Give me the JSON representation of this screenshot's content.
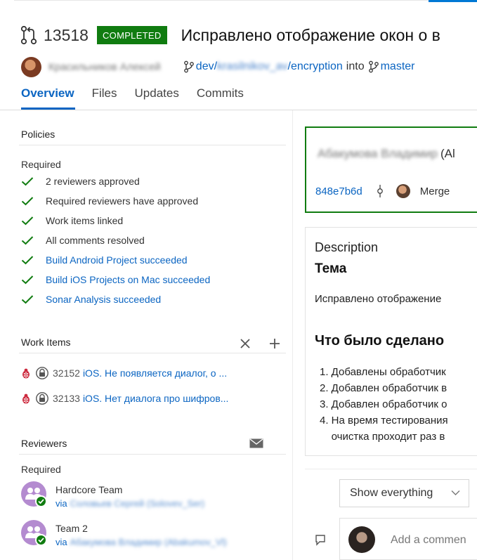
{
  "header": {
    "pr_number": "13518",
    "status_badge": "COMPLETED",
    "title": "Исправлено отображение окон о в",
    "author": "Красильников Алексей",
    "source_branch_prefix": "dev/",
    "source_branch_user": "krasilnikov_av",
    "source_branch_suffix": "/encryption",
    "into": "into",
    "target_branch": "master",
    "tabs": [
      "Overview",
      "Files",
      "Updates",
      "Commits"
    ]
  },
  "policies": {
    "title": "Policies",
    "required_label": "Required",
    "items": [
      {
        "label": "2 reviewers approved",
        "link": false
      },
      {
        "label": "Required reviewers have approved",
        "link": false
      },
      {
        "label": "Work items linked",
        "link": false
      },
      {
        "label": "All comments resolved",
        "link": false
      },
      {
        "label": "Build Android Project succeeded",
        "link": true
      },
      {
        "label": "Build iOS Projects on Mac succeeded",
        "link": true
      },
      {
        "label": "Sonar Analysis succeeded",
        "link": true
      }
    ]
  },
  "work_items": {
    "title": "Work Items",
    "items": [
      {
        "id": "32152",
        "title": "iOS. Не появляется диалог, о ..."
      },
      {
        "id": "32133",
        "title": "iOS. Нет диалога про шифров..."
      }
    ]
  },
  "reviewers": {
    "title": "Reviewers",
    "required_label": "Required",
    "items": [
      {
        "name": "Hardcore Team",
        "via": "via",
        "via_name": "Соловьев Сергей (Solovev_Ser)"
      },
      {
        "name": "Team 2",
        "via": "via",
        "via_name": "Абакумова Владимир (Abakumov_Vl)"
      }
    ]
  },
  "merge_card": {
    "name": "Абакумова Владимир",
    "name_suffix": "(Al",
    "commit": "848e7b6d",
    "merged": "Merge"
  },
  "description": {
    "label": "Description",
    "heading": "Тема",
    "text": "Исправлено отображение",
    "heading2": "Что было сделано",
    "list": [
      "1. Добавлены обработчик",
      "2. Добавлен обработчик в",
      "3. Добавлен обработчик о",
      "4. На время тестирования",
      "    очистка проходит раз в"
    ]
  },
  "filter": {
    "selected": "Show everything"
  },
  "comment": {
    "placeholder": "Add a commen"
  },
  "colors": {
    "accent": "#0b65c2",
    "success": "#107c10",
    "reviewer_avatar": "#b48bd0"
  }
}
